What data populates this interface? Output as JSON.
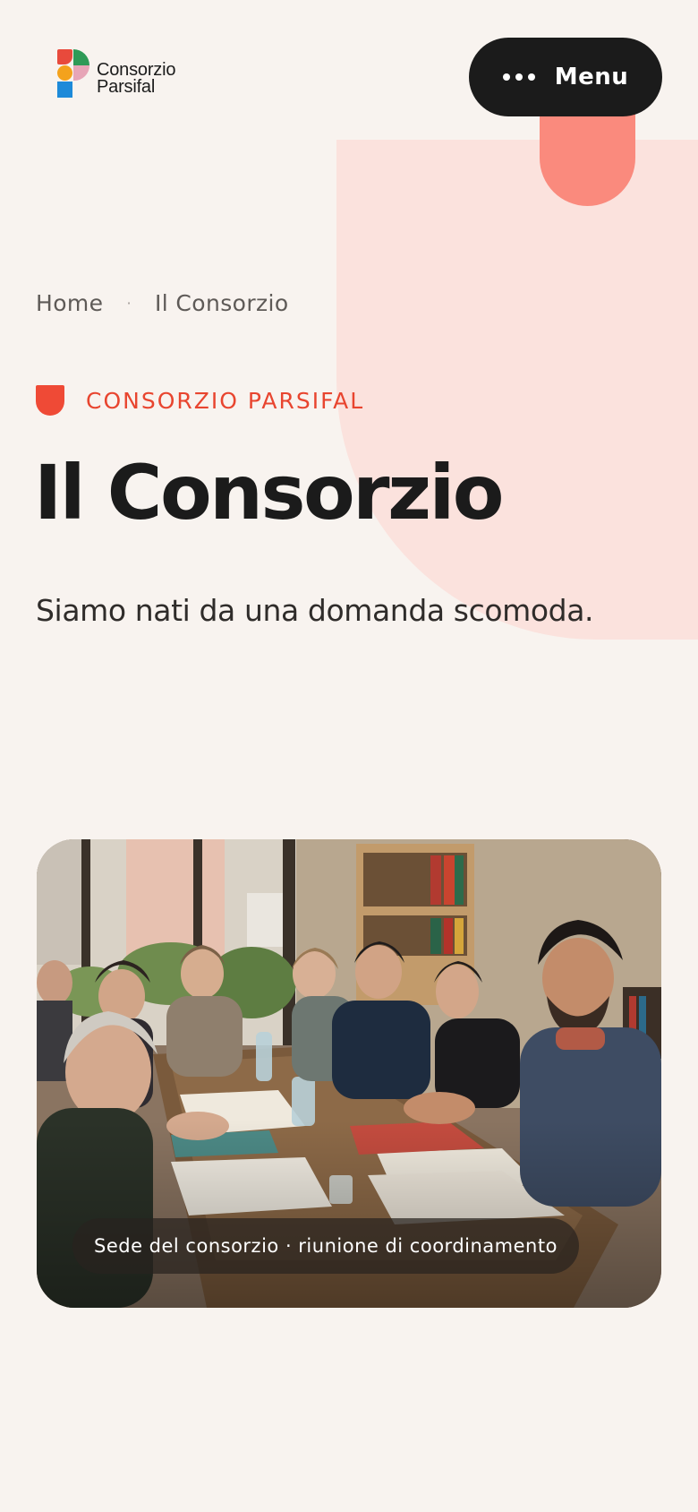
{
  "brand": {
    "name_line1": "Consorzio",
    "name_line2": "Parsifal",
    "colors": {
      "red": "#e84a3c",
      "green": "#2f9a57",
      "pink": "#e7a5b7",
      "orange": "#f4a21c",
      "blue": "#1d8ad9"
    }
  },
  "header": {
    "menu_label": "Menu",
    "menu_icon": "more-dots-icon"
  },
  "breadcrumb": {
    "items": [
      {
        "label": "Home"
      },
      {
        "label": "Il Consorzio"
      }
    ],
    "separator": "·"
  },
  "hero": {
    "eyebrow": "CONSORZIO PARSIFAL",
    "title": "Il Consorzio",
    "subtitle": "Siamo nati da una domanda scomoda.",
    "accent_color": "#ef4a36",
    "background_tint": "#fbe2dd"
  },
  "photo": {
    "caption": "Sede del consorzio · riunione di coordinamento"
  }
}
